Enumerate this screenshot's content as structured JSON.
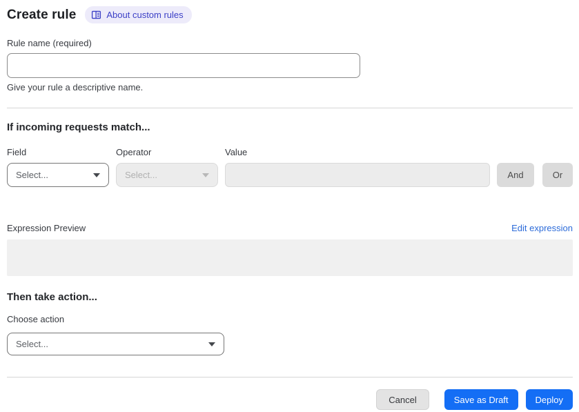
{
  "header": {
    "title": "Create rule",
    "about_link": "About custom rules"
  },
  "rule_name": {
    "label": "Rule name (required)",
    "value": "",
    "helper": "Give your rule a descriptive name."
  },
  "match_section": {
    "heading": "If incoming requests match...",
    "field": {
      "label": "Field",
      "placeholder": "Select..."
    },
    "operator": {
      "label": "Operator",
      "placeholder": "Select..."
    },
    "value": {
      "label": "Value",
      "value": ""
    },
    "and_button": "And",
    "or_button": "Or"
  },
  "expression": {
    "label": "Expression Preview",
    "edit_link": "Edit expression",
    "content": ""
  },
  "action_section": {
    "heading": "Then take action...",
    "choose_label": "Choose action",
    "placeholder": "Select..."
  },
  "footer": {
    "cancel": "Cancel",
    "save_draft": "Save as Draft",
    "deploy": "Deploy"
  },
  "icons": {
    "about_badge": "book-icon",
    "selects": "chevron-down-icon"
  },
  "colors": {
    "primary_blue": "#146EF5",
    "link_blue": "#2C6BD9",
    "badge_bg": "#EDEBFA",
    "badge_text": "#3B3FC6",
    "disabled_bg": "#ECECEC",
    "gray_button_bg": "#DBDBDB",
    "preview_bg": "#F0F0F0"
  }
}
